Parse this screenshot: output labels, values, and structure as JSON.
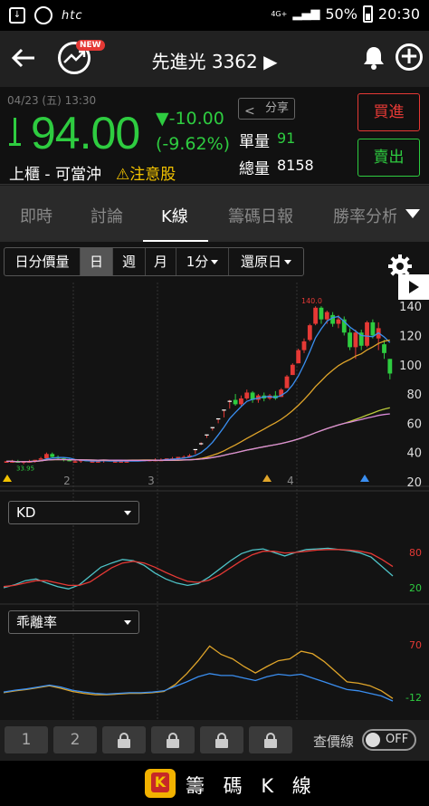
{
  "status_bar": {
    "brand": "htc",
    "network": "4G+",
    "battery": "50%",
    "time": "20:30"
  },
  "app_bar": {
    "title": "先進光 3362 ▶",
    "new_badge": "NEW"
  },
  "quote": {
    "datetime": "04/23 (五) 13:30",
    "price": "94.00",
    "change": "▼-10.00",
    "change_pct": "(-9.62%)",
    "market": "上櫃 - 可當沖",
    "warning": "⚠注意股",
    "share_label": "分享",
    "unit_vol_label": "單量",
    "unit_vol": "91",
    "total_vol_label": "總量",
    "total_vol": "8158",
    "buy_label": "買進",
    "sell_label": "賣出"
  },
  "tabs": [
    {
      "label": "即時"
    },
    {
      "label": "討論"
    },
    {
      "label": "K線"
    },
    {
      "label": "籌碼日報"
    },
    {
      "label": "勝率分析"
    }
  ],
  "chart_toolbar": {
    "items": [
      "日分價量",
      "日",
      "週",
      "月",
      "1分",
      "還原日"
    ],
    "selected": "日"
  },
  "indicators": {
    "kd_label": "KD",
    "bias_label": "乖離率"
  },
  "chart_data": [
    {
      "type": "candlestick",
      "title": "K線",
      "ylim": [
        20,
        150
      ],
      "y_ticks": [
        "140",
        "120",
        "100",
        "80",
        "60",
        "40",
        "20"
      ],
      "x_ticks": [
        "2",
        "3",
        "4"
      ],
      "annotations": [
        "140.0",
        "33.95"
      ],
      "series": [
        {
          "name": "MA short",
          "color": "#3a8ef0"
        },
        {
          "name": "MA mid",
          "color": "#e0a52a"
        },
        {
          "name": "MA long",
          "color": "#b8c83a"
        },
        {
          "name": "MA longest",
          "color": "#d98ad8"
        }
      ],
      "candles": [
        {
          "o": 33,
          "h": 34,
          "l": 33,
          "c": 34
        },
        {
          "o": 34,
          "h": 35,
          "l": 33,
          "c": 34
        },
        {
          "o": 34,
          "h": 35,
          "l": 33,
          "c": 33
        },
        {
          "o": 33,
          "h": 34,
          "l": 32,
          "c": 34
        },
        {
          "o": 34,
          "h": 35,
          "l": 33,
          "c": 34
        },
        {
          "o": 34,
          "h": 35,
          "l": 33,
          "c": 35
        },
        {
          "o": 35,
          "h": 37,
          "l": 34,
          "c": 36
        },
        {
          "o": 36,
          "h": 40,
          "l": 35,
          "c": 39
        },
        {
          "o": 39,
          "h": 40,
          "l": 36,
          "c": 37
        },
        {
          "o": 37,
          "h": 38,
          "l": 35,
          "c": 36
        },
        {
          "o": 36,
          "h": 37,
          "l": 34,
          "c": 35
        },
        {
          "o": 35,
          "h": 36,
          "l": 34,
          "c": 34
        },
        {
          "o": 34,
          "h": 35,
          "l": 33,
          "c": 34
        },
        {
          "o": 34,
          "h": 35,
          "l": 33,
          "c": 35
        },
        {
          "o": 35,
          "h": 35,
          "l": 34,
          "c": 34
        },
        {
          "o": 34,
          "h": 35,
          "l": 33,
          "c": 34
        },
        {
          "o": 34,
          "h": 35,
          "l": 33,
          "c": 34
        },
        {
          "o": 34,
          "h": 35,
          "l": 33,
          "c": 35
        },
        {
          "o": 35,
          "h": 35,
          "l": 34,
          "c": 34
        },
        {
          "o": 34,
          "h": 35,
          "l": 33,
          "c": 34
        },
        {
          "o": 34,
          "h": 35,
          "l": 33,
          "c": 34
        },
        {
          "o": 34,
          "h": 35,
          "l": 33,
          "c": 34
        },
        {
          "o": 34,
          "h": 35,
          "l": 34,
          "c": 35
        },
        {
          "o": 35,
          "h": 35,
          "l": 34,
          "c": 34
        },
        {
          "o": 34,
          "h": 35,
          "l": 34,
          "c": 35
        },
        {
          "o": 35,
          "h": 35,
          "l": 34,
          "c": 35
        },
        {
          "o": 35,
          "h": 36,
          "l": 34,
          "c": 35
        },
        {
          "o": 35,
          "h": 36,
          "l": 35,
          "c": 35
        },
        {
          "o": 35,
          "h": 36,
          "l": 35,
          "c": 36
        },
        {
          "o": 36,
          "h": 37,
          "l": 35,
          "c": 36
        },
        {
          "o": 36,
          "h": 37,
          "l": 35,
          "c": 37
        },
        {
          "o": 37,
          "h": 38,
          "l": 36,
          "c": 37
        },
        {
          "o": 37,
          "h": 39,
          "l": 37,
          "c": 38
        },
        {
          "o": 39,
          "h": 42,
          "l": 39,
          "c": 42
        },
        {
          "o": 45,
          "h": 47,
          "l": 45,
          "c": 46
        },
        {
          "o": 50,
          "h": 52,
          "l": 50,
          "c": 52
        },
        {
          "o": 55,
          "h": 57,
          "l": 55,
          "c": 57
        },
        {
          "o": 60,
          "h": 63,
          "l": 60,
          "c": 63
        },
        {
          "o": 64,
          "h": 69,
          "l": 64,
          "c": 69
        },
        {
          "o": 70,
          "h": 76,
          "l": 70,
          "c": 75
        },
        {
          "o": 76,
          "h": 80,
          "l": 72,
          "c": 73
        },
        {
          "o": 73,
          "h": 79,
          "l": 72,
          "c": 77
        },
        {
          "o": 77,
          "h": 83,
          "l": 76,
          "c": 81
        },
        {
          "o": 81,
          "h": 82,
          "l": 74,
          "c": 76
        },
        {
          "o": 76,
          "h": 80,
          "l": 74,
          "c": 79
        },
        {
          "o": 79,
          "h": 81,
          "l": 75,
          "c": 77
        },
        {
          "o": 77,
          "h": 80,
          "l": 76,
          "c": 79
        },
        {
          "o": 79,
          "h": 82,
          "l": 76,
          "c": 77
        },
        {
          "o": 78,
          "h": 84,
          "l": 78,
          "c": 83
        },
        {
          "o": 84,
          "h": 93,
          "l": 84,
          "c": 92
        },
        {
          "o": 93,
          "h": 101,
          "l": 93,
          "c": 100
        },
        {
          "o": 101,
          "h": 111,
          "l": 101,
          "c": 110
        },
        {
          "o": 110,
          "h": 118,
          "l": 108,
          "c": 116
        },
        {
          "o": 117,
          "h": 128,
          "l": 116,
          "c": 127
        },
        {
          "o": 128,
          "h": 140,
          "l": 127,
          "c": 139
        },
        {
          "o": 139,
          "h": 140,
          "l": 128,
          "c": 131
        },
        {
          "o": 131,
          "h": 137,
          "l": 128,
          "c": 136
        },
        {
          "o": 134,
          "h": 136,
          "l": 126,
          "c": 128
        },
        {
          "o": 128,
          "h": 134,
          "l": 125,
          "c": 131
        },
        {
          "o": 131,
          "h": 133,
          "l": 120,
          "c": 122
        },
        {
          "o": 122,
          "h": 125,
          "l": 110,
          "c": 112
        },
        {
          "o": 112,
          "h": 124,
          "l": 104,
          "c": 122
        },
        {
          "o": 122,
          "h": 124,
          "l": 110,
          "c": 113
        },
        {
          "o": 113,
          "h": 130,
          "l": 112,
          "c": 129
        },
        {
          "o": 129,
          "h": 131,
          "l": 118,
          "c": 120
        },
        {
          "o": 118,
          "h": 129,
          "l": 110,
          "c": 125
        },
        {
          "o": 114,
          "h": 117,
          "l": 104,
          "c": 108
        },
        {
          "o": 104,
          "h": 104,
          "l": 90,
          "c": 94
        }
      ],
      "markers": [
        "yellow-triangle",
        "orange-triangle",
        "blue-triangle"
      ]
    },
    {
      "type": "line",
      "title": "KD",
      "y_ticks": [
        "80",
        "20"
      ],
      "series": [
        {
          "name": "K",
          "color": "#4fc3c7",
          "values": [
            20,
            25,
            32,
            35,
            28,
            22,
            18,
            25,
            40,
            55,
            62,
            68,
            66,
            58,
            45,
            35,
            28,
            24,
            27,
            38,
            52,
            66,
            78,
            84,
            86,
            80,
            74,
            80,
            85,
            86,
            87,
            85,
            83,
            79,
            72,
            56,
            40
          ]
        },
        {
          "name": "D",
          "color": "#e53935",
          "values": [
            22,
            24,
            28,
            32,
            32,
            28,
            24,
            24,
            30,
            42,
            54,
            62,
            65,
            62,
            55,
            46,
            38,
            31,
            29,
            33,
            42,
            54,
            66,
            76,
            82,
            82,
            79,
            80,
            82,
            84,
            85,
            85,
            84,
            82,
            78,
            68,
            56
          ]
        }
      ]
    },
    {
      "type": "line",
      "title": "乖離率",
      "y_ticks": [
        "70",
        "-12"
      ],
      "series": [
        {
          "name": "orange",
          "color": "#e0a52a",
          "values": [
            -5,
            -2,
            0,
            3,
            6,
            2,
            -3,
            -6,
            -8,
            -8,
            -7,
            -6,
            -6,
            -5,
            -3,
            8,
            25,
            45,
            68,
            55,
            48,
            36,
            26,
            36,
            45,
            48,
            60,
            56,
            44,
            28,
            12,
            10,
            6,
            -2,
            -14
          ]
        },
        {
          "name": "blue",
          "color": "#3a8ef0",
          "values": [
            -4,
            -1,
            1,
            4,
            7,
            4,
            -1,
            -4,
            -6,
            -7,
            -6,
            -5,
            -5,
            -4,
            -2,
            5,
            12,
            20,
            25,
            22,
            22,
            18,
            14,
            20,
            24,
            22,
            24,
            18,
            12,
            6,
            0,
            -2,
            -6,
            -10,
            -18
          ]
        }
      ]
    }
  ],
  "bottom_bar": {
    "slots": [
      "1",
      "2"
    ],
    "price_line_label": "查價線",
    "toggle_state": "OFF"
  },
  "footer": {
    "title": "籌 碼 K 線",
    "logo_letter": "K"
  }
}
